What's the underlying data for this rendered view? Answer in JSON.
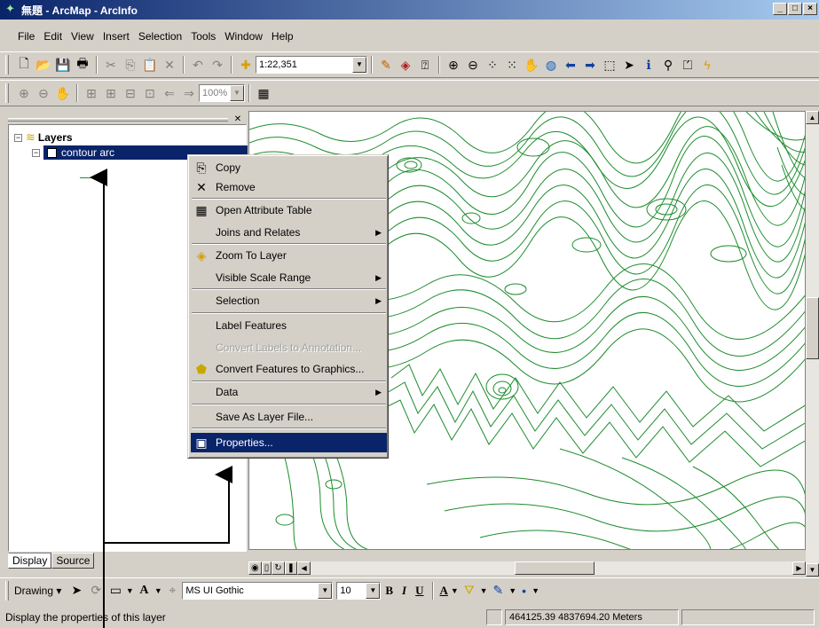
{
  "window": {
    "title": "無題 - ArcMap - ArcInfo",
    "minimize": "_",
    "maximize": "□",
    "close": "×"
  },
  "menubar": {
    "items": [
      "File",
      "Edit",
      "View",
      "Insert",
      "Selection",
      "Tools",
      "Window",
      "Help"
    ]
  },
  "toolbar": {
    "scale_value": "1:22,351",
    "zoom_value": "100%"
  },
  "toc": {
    "root_label": "Layers",
    "layer_label": "contour arc",
    "layer_checked": true,
    "tab_display": "Display",
    "tab_source": "Source"
  },
  "context_menu": {
    "items": [
      {
        "label": "Copy",
        "icon": "copy-icon",
        "enabled": true
      },
      {
        "label": "Remove",
        "icon": "remove-icon",
        "enabled": true
      },
      {
        "label": "Open Attribute Table",
        "icon": "table-icon",
        "enabled": true
      },
      {
        "label": "Joins and Relates",
        "icon": "",
        "enabled": true,
        "submenu": true
      },
      {
        "label": "Zoom To Layer",
        "icon": "zoom-to-layer-icon",
        "enabled": true
      },
      {
        "label": "Visible Scale Range",
        "icon": "",
        "enabled": true,
        "submenu": true
      },
      {
        "label": "Selection",
        "icon": "",
        "enabled": true,
        "submenu": true
      },
      {
        "label": "Label Features",
        "icon": "",
        "enabled": true
      },
      {
        "label": "Convert Labels to Annotation...",
        "icon": "",
        "enabled": false
      },
      {
        "label": "Convert Features to Graphics...",
        "icon": "convert-graphics-icon",
        "enabled": true
      },
      {
        "label": "Data",
        "icon": "",
        "enabled": true,
        "submenu": true
      },
      {
        "label": "Save As Layer File...",
        "icon": "",
        "enabled": true
      },
      {
        "label": "Properties...",
        "icon": "properties-icon",
        "enabled": true,
        "highlighted": true
      }
    ]
  },
  "drawing_toolbar": {
    "drawing_label": "Drawing",
    "font_name": "MS UI Gothic",
    "font_size": "10",
    "bold": "B",
    "italic": "I",
    "underline": "U",
    "font_color_letter": "A"
  },
  "statusbar": {
    "message": "Display the properties of this layer",
    "coordinates": "464125.39  4837694.20 Meters"
  },
  "colors": {
    "contour": "#1c8c2c",
    "selection": "#0a246a",
    "face": "#d4d0c8"
  }
}
